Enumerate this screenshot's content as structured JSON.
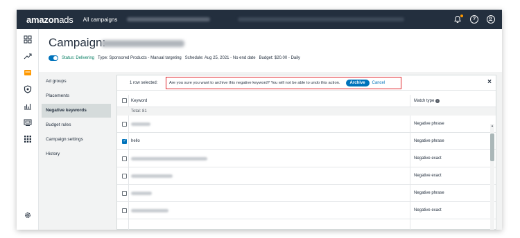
{
  "topbar": {
    "brand_main": "amazon",
    "brand_ads": "ads",
    "crumb": "All campaigns",
    "icons": [
      "bell-icon",
      "help-icon",
      "account-icon"
    ]
  },
  "rail": {
    "icons": [
      "dashboard-icon",
      "trend-icon",
      "campaign-icon",
      "shield-icon",
      "reports-icon",
      "media-icon",
      "apps-icon",
      "settings-icon"
    ]
  },
  "header": {
    "title": "Campaign:",
    "status_label": "Status: Delivering",
    "type": "Type: Sponsored Products - Manual targeting",
    "schedule": "Schedule: Aug 25, 2021 - No end date",
    "budget": "Budget: $20.00 - Daily"
  },
  "nav": {
    "items": [
      {
        "label": "Ad groups"
      },
      {
        "label": "Placements"
      },
      {
        "label": "Negative keywords"
      },
      {
        "label": "Budget rules"
      },
      {
        "label": "Campaign settings"
      },
      {
        "label": "History"
      }
    ]
  },
  "selection": {
    "count": "1 row selected:",
    "confirm": "Are you sure you want to archive this negative keyword? You will not be able to undo this action.",
    "archive": "Archive",
    "cancel": "Cancel",
    "close": "×"
  },
  "table": {
    "col_keyword": "Keyword",
    "col_match": "Match type",
    "total": "Total: 81",
    "rows": [
      {
        "keyword": "",
        "match": "Negative phrase",
        "checked": false
      },
      {
        "keyword": "hello",
        "match": "Negative phrase",
        "checked": true
      },
      {
        "keyword": "",
        "match": "Negative exact",
        "checked": false
      },
      {
        "keyword": "",
        "match": "Negative exact",
        "checked": false
      },
      {
        "keyword": "",
        "match": "Negative phrase",
        "checked": false
      },
      {
        "keyword": "",
        "match": "Negative exact",
        "checked": false
      }
    ]
  },
  "colors": {
    "topbar": "#232f3e",
    "accent": "#0073bb",
    "alert_border": "#e0252b",
    "delivering": "#067d62"
  }
}
